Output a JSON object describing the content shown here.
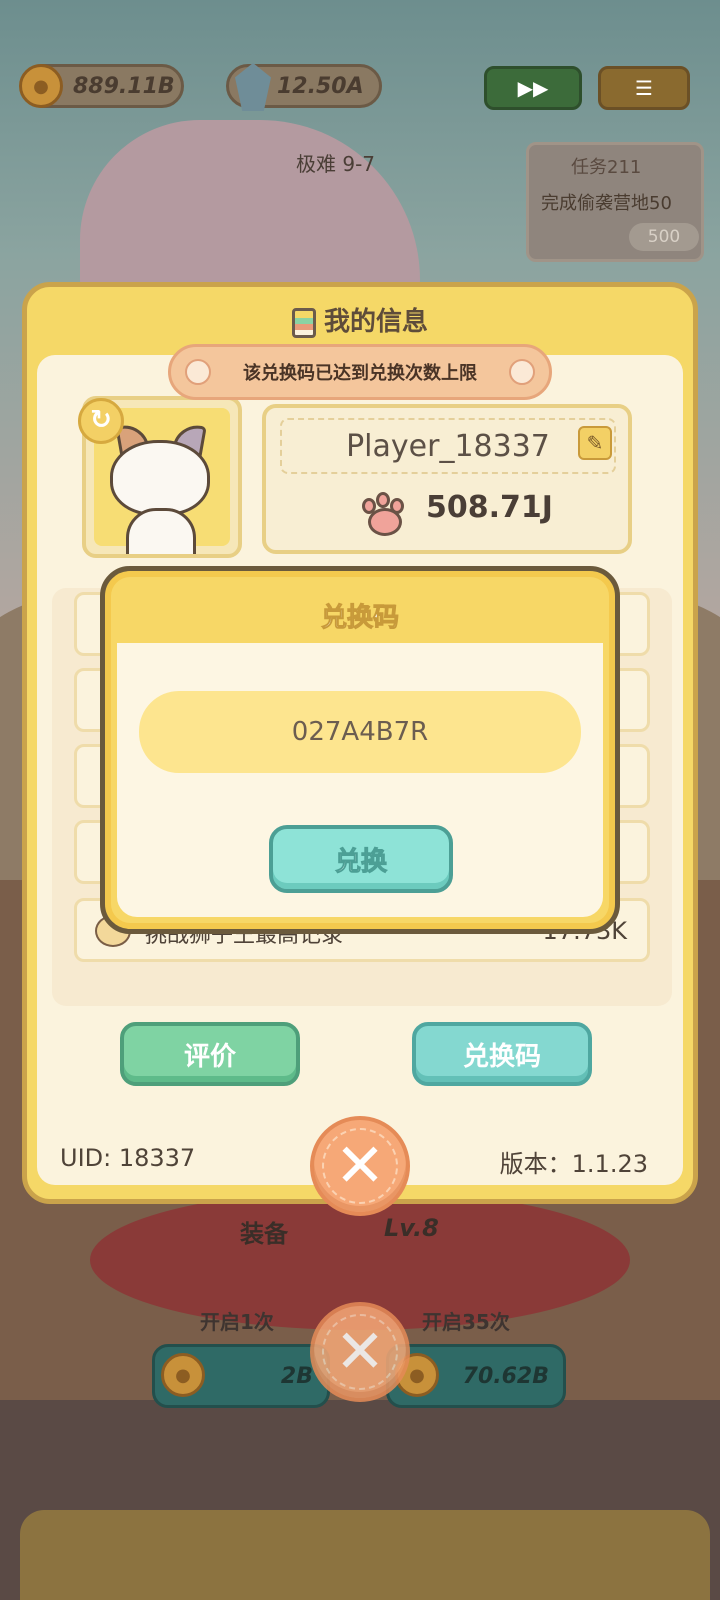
{
  "top_bar": {
    "coins": "889.11B",
    "gems": "12.50A"
  },
  "level": {
    "difficulty": "极难 9-7"
  },
  "task": {
    "title": "任务211",
    "desc": "完成偷袭营地50",
    "reward": "500"
  },
  "panel": {
    "title": "我的信息",
    "player_name": "Player_18337",
    "paw_value": "508.71J",
    "stats": [
      {
        "label": "挑战狮子王最高记录",
        "value": "17.73K"
      }
    ],
    "rate_label": "评价",
    "redeem_label": "兑换码",
    "uid": "UID: 18337",
    "version": "版本：1.1.23"
  },
  "toast": {
    "message": "该兑换码已达到兑换次数上限"
  },
  "modal": {
    "title": "兑换码",
    "code_value": "027A4B7R",
    "submit_label": "兑换"
  },
  "background": {
    "equip_label": "装备",
    "equip_level": "Lv.8",
    "open_once": "开启1次",
    "open_35": "开启35次",
    "price_once": "2B",
    "price_35": "70.62B"
  },
  "colors": {
    "panel_yellow": "#f5d867",
    "toast_orange": "#f4c69c",
    "teal_button": "#8ee3d7",
    "close_orange": "#f6a877"
  }
}
